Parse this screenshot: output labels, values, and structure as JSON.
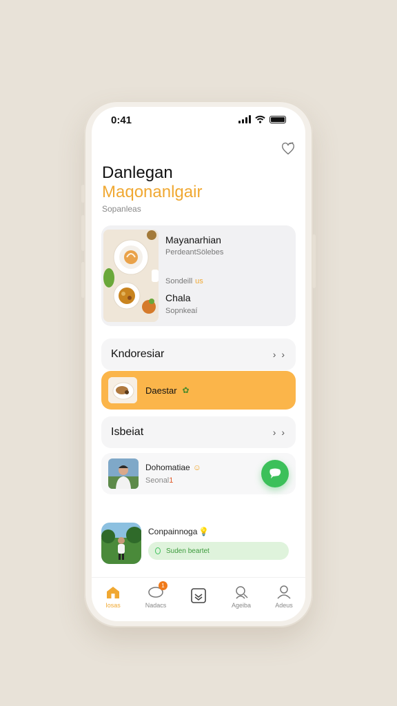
{
  "status_bar": {
    "time": "0:41"
  },
  "header": {
    "title_line1": "Danlegan",
    "title_line2": "Maqonanlgair",
    "subtitle": "Sopanleas"
  },
  "feature_card": {
    "title": "Mayanarhian",
    "subtitle": "PerdeantSölebes",
    "meta": "Sondeill",
    "meta_tag": "us",
    "name": "Chala",
    "note": "Sopnkeaí"
  },
  "list_rows": [
    {
      "label": "Kndoresiar",
      "chevron": "› ›"
    },
    {
      "label": "Isbeiat",
      "chevron": "› ›"
    }
  ],
  "highlight_row": {
    "label": "Daestar",
    "badge": "✿"
  },
  "person_row": {
    "name": "Dohomatiae",
    "name_icon": "☺",
    "sub": "Seonal",
    "sub_mark": "1"
  },
  "bottom_item": {
    "name": "Conpainnoga",
    "name_icon": "💡",
    "pill": "Suden beartet"
  },
  "tabs": [
    {
      "label": "Iosas",
      "icon": "home-icon",
      "active": true
    },
    {
      "label": "Nadacs",
      "icon": "chat-icon",
      "badge": "1"
    },
    {
      "label": "",
      "icon": "inbox-icon"
    },
    {
      "label": "Ageiba",
      "icon": "search-person-icon"
    },
    {
      "label": "Adeus",
      "icon": "profile-icon"
    }
  ],
  "colors": {
    "accent": "#f0a832",
    "highlight": "#fbb54a",
    "fab": "#3cc05a",
    "badge": "#f07a1a"
  }
}
